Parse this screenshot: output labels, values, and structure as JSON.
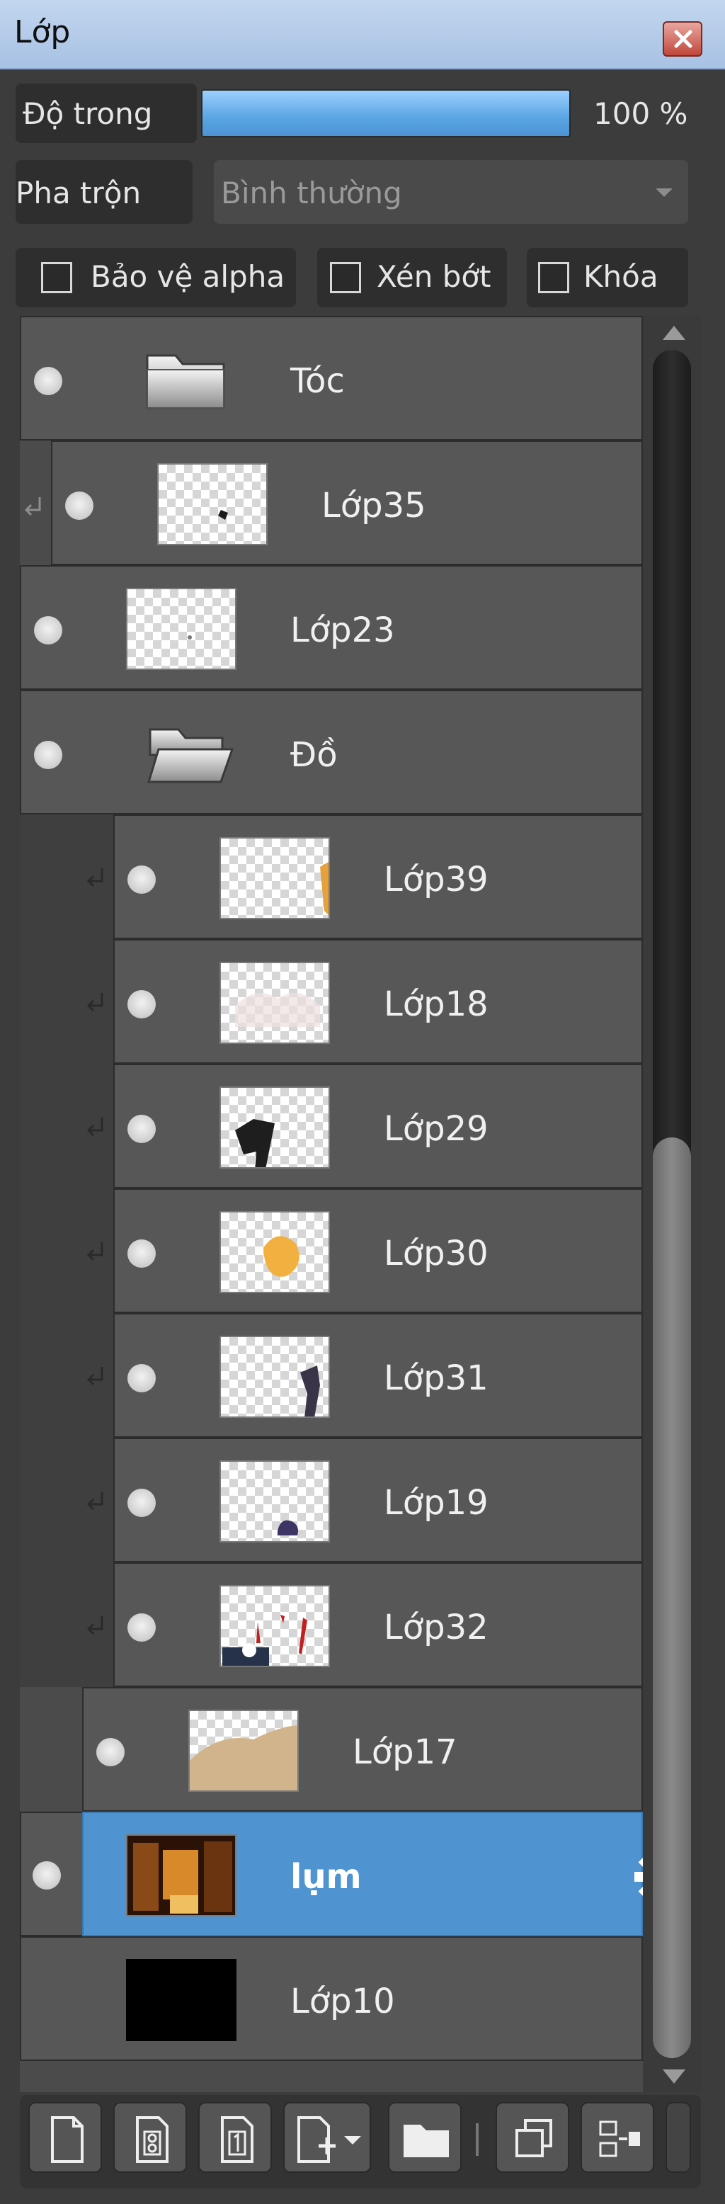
{
  "window": {
    "title": "Lớp"
  },
  "opacity": {
    "label": "Độ trong",
    "value": "100 %",
    "fraction": 1.0
  },
  "blend": {
    "label": "Pha trộn",
    "value": "Bình thường"
  },
  "options": {
    "protect_alpha": "Bảo vệ alpha",
    "clip": "Xén bớt",
    "lock": "Khóa"
  },
  "layers": [
    {
      "name": "Tóc",
      "type": "folder-closed"
    },
    {
      "name": "Lớp35",
      "type": "layer",
      "clipped": true
    },
    {
      "name": "Lớp23",
      "type": "layer"
    },
    {
      "name": "Đồ",
      "type": "folder-open"
    },
    {
      "name": "Lớp39",
      "type": "layer",
      "clipped": true
    },
    {
      "name": "Lớp18",
      "type": "layer",
      "clipped": true
    },
    {
      "name": "Lớp29",
      "type": "layer",
      "clipped": true
    },
    {
      "name": "Lớp30",
      "type": "layer",
      "clipped": true
    },
    {
      "name": "Lớp31",
      "type": "layer",
      "clipped": true
    },
    {
      "name": "Lớp19",
      "type": "layer",
      "clipped": true
    },
    {
      "name": "Lớp32",
      "type": "layer",
      "clipped": true
    },
    {
      "name": "Lớp17",
      "type": "layer"
    },
    {
      "name": "lụm",
      "type": "layer",
      "selected": true
    },
    {
      "name": "Lớp10",
      "type": "layer",
      "hidden": true
    }
  ],
  "colors": {
    "selected": "#4f94d0",
    "row": "#575757",
    "accent": "#5aa5e4"
  },
  "toolbar_icons": [
    "new-layer-icon",
    "new-8bit-layer-icon",
    "new-1bit-layer-icon",
    "new-layer-menu-icon",
    "new-folder-icon",
    "duplicate-layer-icon",
    "merge-down-icon"
  ]
}
